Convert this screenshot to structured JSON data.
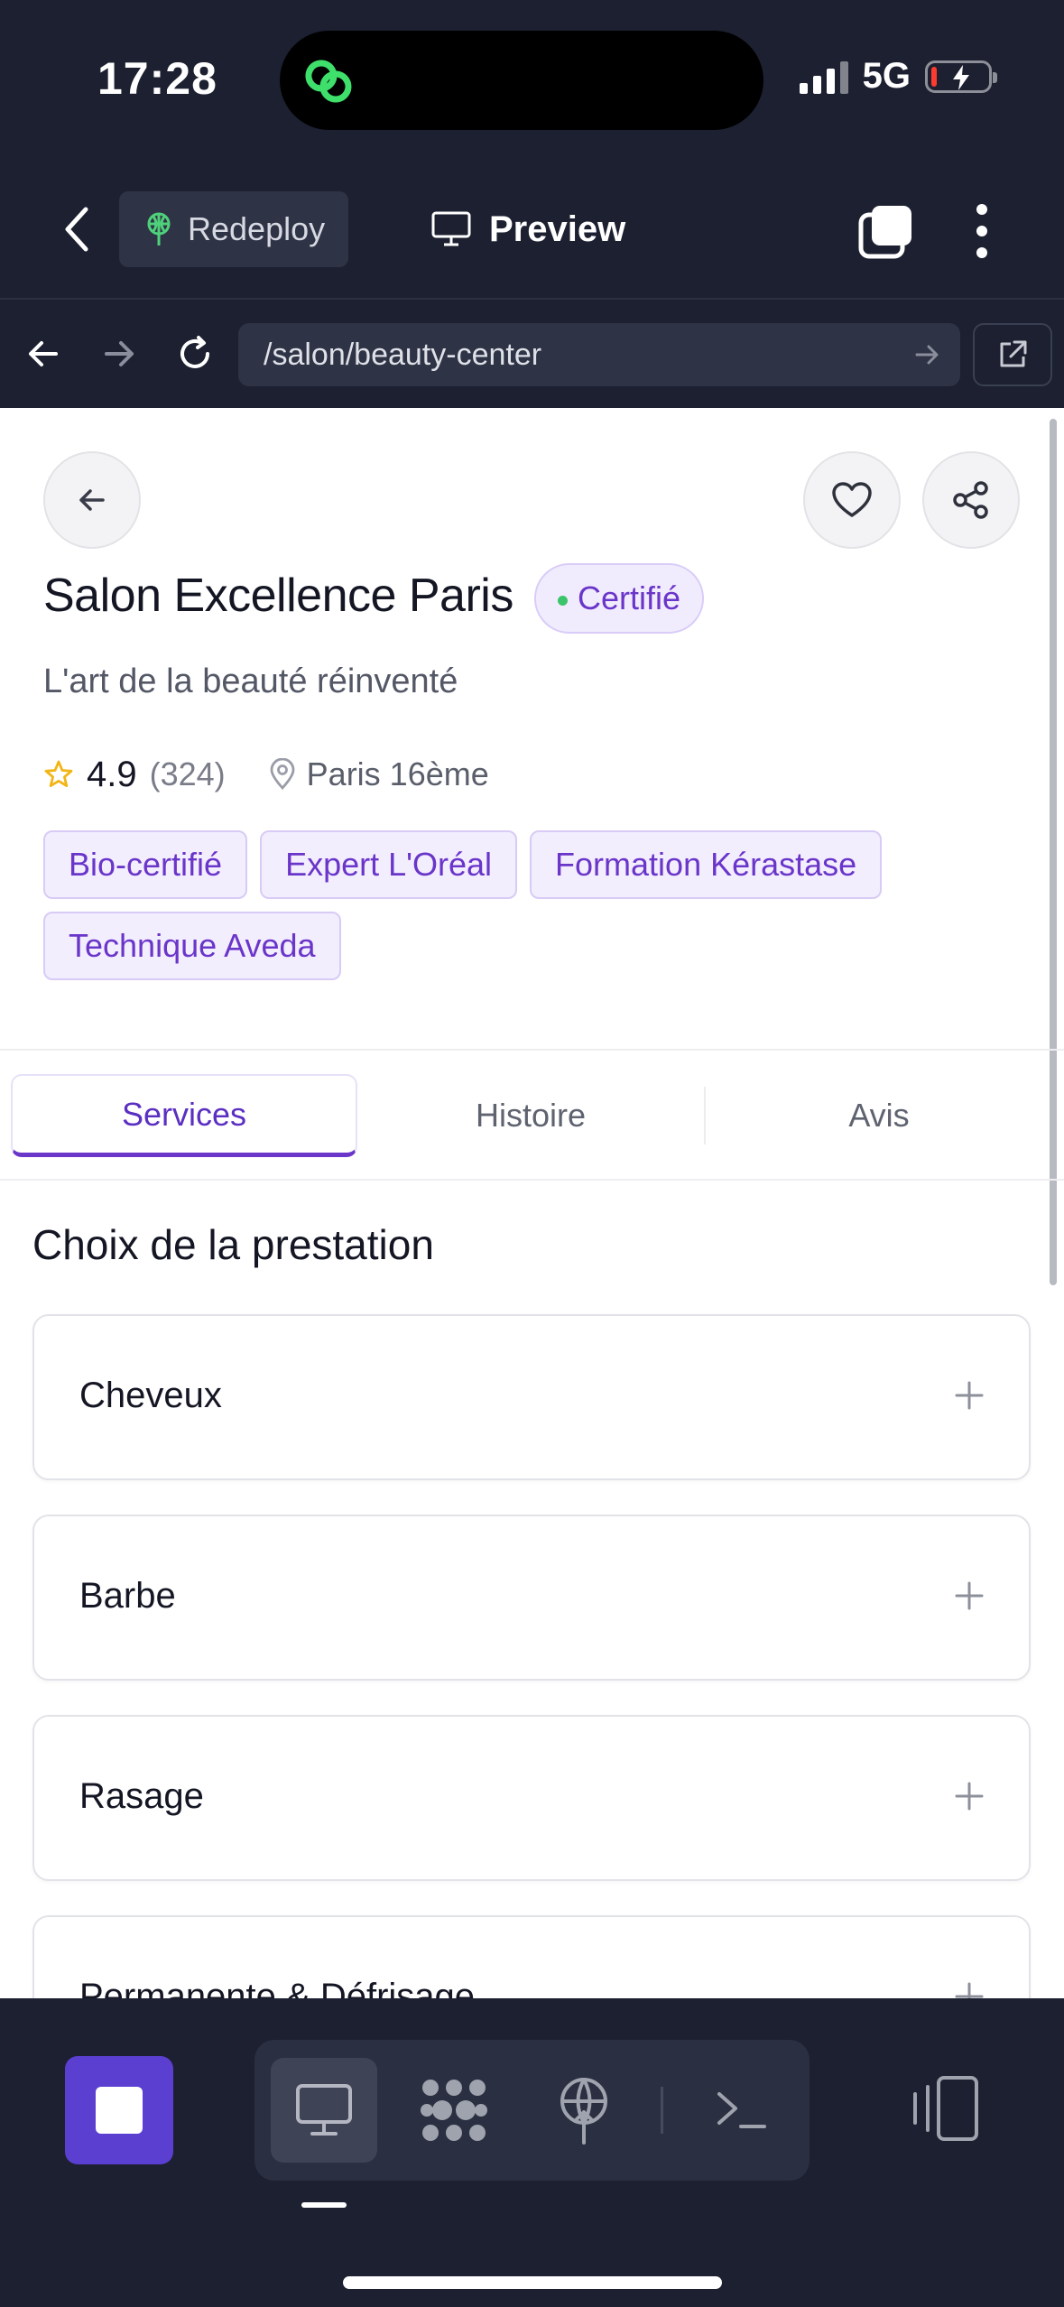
{
  "status_bar": {
    "time": "17:28",
    "network": "5G",
    "battery_level_fraction": 0.1,
    "battery_color": "#ff3b30",
    "island_app_icon": "link-rings-icon",
    "island_icon_color": "#3ee06b"
  },
  "app_header": {
    "back_icon": "chevron-left-icon",
    "redeploy_label": "Redeploy",
    "redeploy_icon": "antenna-icon",
    "preview_label": "Preview",
    "preview_icon": "monitor-icon",
    "tabs_icon": "tabs-icon",
    "more_icon": "more-vertical-icon"
  },
  "browser": {
    "url": "/salon/beauty-center",
    "icons": [
      "arrow-left-icon",
      "arrow-right-icon",
      "reload-icon",
      "arrow-go-icon",
      "external-link-icon"
    ]
  },
  "salon": {
    "name": "Salon Excellence Paris",
    "badge": "Certifié",
    "tagline": "L'art de la beauté réinventé",
    "rating": "4.9",
    "reviews": "(324)",
    "location": "Paris 16ème",
    "tags": [
      "Bio-certifié",
      "Expert L'Oréal",
      "Formation Kérastase",
      "Technique Aveda"
    ],
    "accent_color": "#6a35c9"
  },
  "tabs": [
    {
      "label": "Services",
      "active": true
    },
    {
      "label": "Histoire",
      "active": false
    },
    {
      "label": "Avis",
      "active": false
    }
  ],
  "services": {
    "title": "Choix de la prestation",
    "items": [
      {
        "label": "Cheveux"
      },
      {
        "label": "Barbe"
      },
      {
        "label": "Rasage"
      },
      {
        "label": "Permanente & Défrisage"
      }
    ]
  },
  "bottom_bar": {
    "stop_color": "#5b3fd1",
    "tools": [
      "monitor-icon",
      "cluster-icon",
      "deploy-icon",
      "terminal-icon"
    ],
    "active_tool": "monitor-icon",
    "right_tool": "device-rotate-icon"
  }
}
